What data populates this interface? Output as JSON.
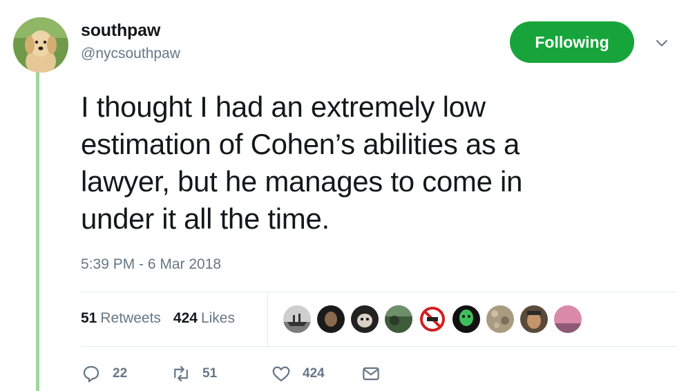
{
  "author": {
    "display_name": "southpaw",
    "handle": "@nycsouthpaw",
    "avatar_icon": "golden-retriever-puppy"
  },
  "follow_button": {
    "label": "Following",
    "color": "#17a53b"
  },
  "tweet": {
    "lines": [
      "I thought I had an extremely low",
      "estimation of Cohen’s abilities as a",
      "lawyer, but he manages to come in",
      "under it all the time."
    ],
    "timestamp": "5:39 PM - 6 Mar 2018"
  },
  "stats": {
    "retweets_count": "51",
    "retweets_label": "Retweets",
    "likes_count": "424",
    "likes_label": "Likes"
  },
  "liker_avatars": [
    "ship-photo",
    "dark-portrait",
    "animal-portrait",
    "landscape-photo",
    "no-fascism-sign",
    "green-mask",
    "texture-photo",
    "man-portrait",
    "pink-sky-photo"
  ],
  "actions": {
    "reply_count": "22",
    "retweet_count": "51",
    "like_count": "424"
  },
  "colors": {
    "thread_line": "#9fd79d",
    "secondary_text": "#657786"
  }
}
